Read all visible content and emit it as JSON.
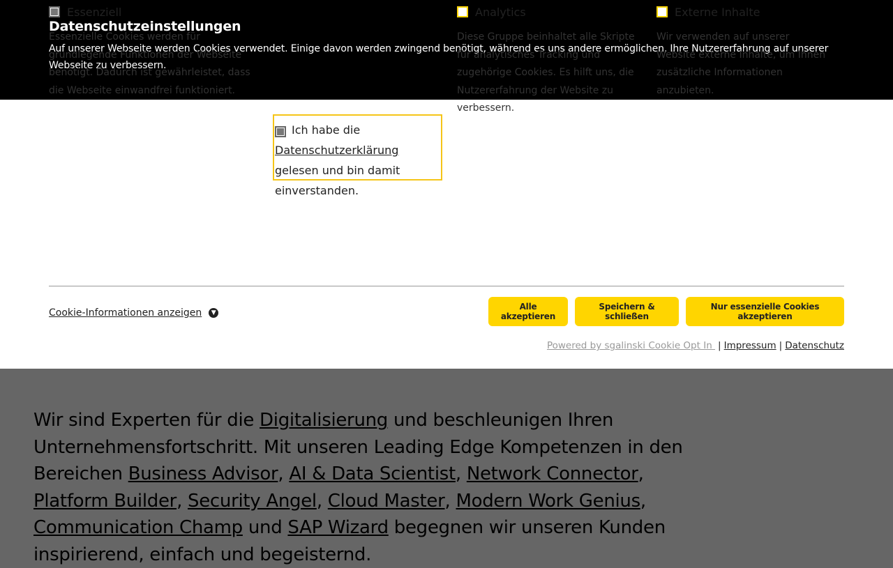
{
  "banner": {
    "title": "Datenschutzeinstellungen",
    "description": "Auf unserer Webseite werden Cookies verwendet. Einige davon werden zwingend benötigt, während es uns andere ermöglichen, Ihre Nutzererfahrung auf unserer Webseite zu verbessern.",
    "groups": [
      {
        "label": "Essenziell",
        "checked": true,
        "text": "Essenzielle Cookies werden für grundlegende Funktionen der Webseite benötigt. Dadurch ist gewährleistet, dass die Webseite einwandfrei funktioniert."
      },
      {
        "label": "Analytics",
        "checked": false,
        "text": "Diese Gruppe beinhaltet alle Skripte für analytisches Tracking und zugehörige Cookies. Es hilft uns, die Nutzererfahrung der Website zu verbessern."
      },
      {
        "label": "Externe Inhalte",
        "checked": false,
        "text": "Wir verwenden auf unserer Website externe Inhalte, um Ihnen zusätzliche Informationen anzubieten."
      }
    ],
    "consent": {
      "prefix": "Ich habe die ",
      "link": "Datenschutzerklärung",
      "suffix": " gelesen und bin damit einverstanden.",
      "checked": true
    },
    "info_link": "Cookie-Informationen anzeigen ",
    "buttons": {
      "accept_all": "Alle akzeptieren",
      "save_close": "Speichern & schließen",
      "essential_only": "Nur essenzielle Cookies akzeptieren"
    },
    "footer": {
      "powered_by": "Powered by sgalinski Cookie Opt In ",
      "separator": "|",
      "imprint": "Impressum",
      "privacy": "Datenschutz"
    }
  },
  "page": {
    "intro_1": "Wir sind Experten für die ",
    "link_digital": "Digitalisierung",
    "intro_2": " und beschleunigen Ihren Unternehmensfortschritt. Mit unseren Leading Edge Kompetenzen in den Bereichen ",
    "link_business": "Business Advisor",
    "comma": ", ",
    "link_ai": "AI & Data Scientist",
    "link_network": "Network Connector",
    "link_platform": "Platform Builder",
    "link_security": "Security Angel",
    "link_cloud": "Cloud Master",
    "link_modern": "Modern Work Genius",
    "link_comm": "Communication Champ",
    "and": " und ",
    "link_sap": "SAP Wizard",
    "outro": " begegnen wir unseren Kunden inspirierend, einfach und begeisternd."
  },
  "colors": {
    "accent": "#ffd500",
    "header_bg": "#000000",
    "overlay": "#666666"
  }
}
